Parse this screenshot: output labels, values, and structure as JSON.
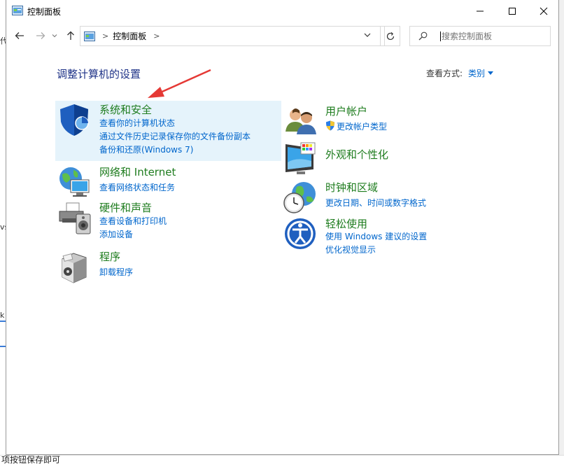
{
  "window": {
    "title": "控制面板"
  },
  "address": {
    "crumb": "控制面板",
    "separator": ">"
  },
  "search": {
    "placeholder": "搜索控制面板"
  },
  "heading": "调整计算机的设置",
  "view_by": {
    "label": "查看方式:",
    "value": "类别"
  },
  "categories_left": [
    {
      "title": "系统和安全",
      "links": [
        "查看你的计算机状态",
        "通过文件历史记录保存你的文件备份副本",
        "备份和还原(Windows 7)"
      ]
    },
    {
      "title": "网络和 Internet",
      "links": [
        "查看网络状态和任务"
      ]
    },
    {
      "title": "硬件和声音",
      "links": [
        "查看设备和打印机",
        "添加设备"
      ]
    },
    {
      "title": "程序",
      "links": [
        "卸载程序"
      ]
    }
  ],
  "categories_right": [
    {
      "title": "用户帐户",
      "links": [
        "更改帐户类型"
      ]
    },
    {
      "title": "外观和个性化",
      "links": []
    },
    {
      "title": "时钟和区域",
      "links": [
        "更改日期、时间或数字格式"
      ]
    },
    {
      "title": "轻松使用",
      "links": [
        "使用 Windows 建议的设置",
        "优化视觉显示"
      ]
    }
  ],
  "background": {
    "frag1": "代",
    "frag2": "vs",
    "frag3": "k",
    "bottom_text": "项按钮保存即可"
  }
}
